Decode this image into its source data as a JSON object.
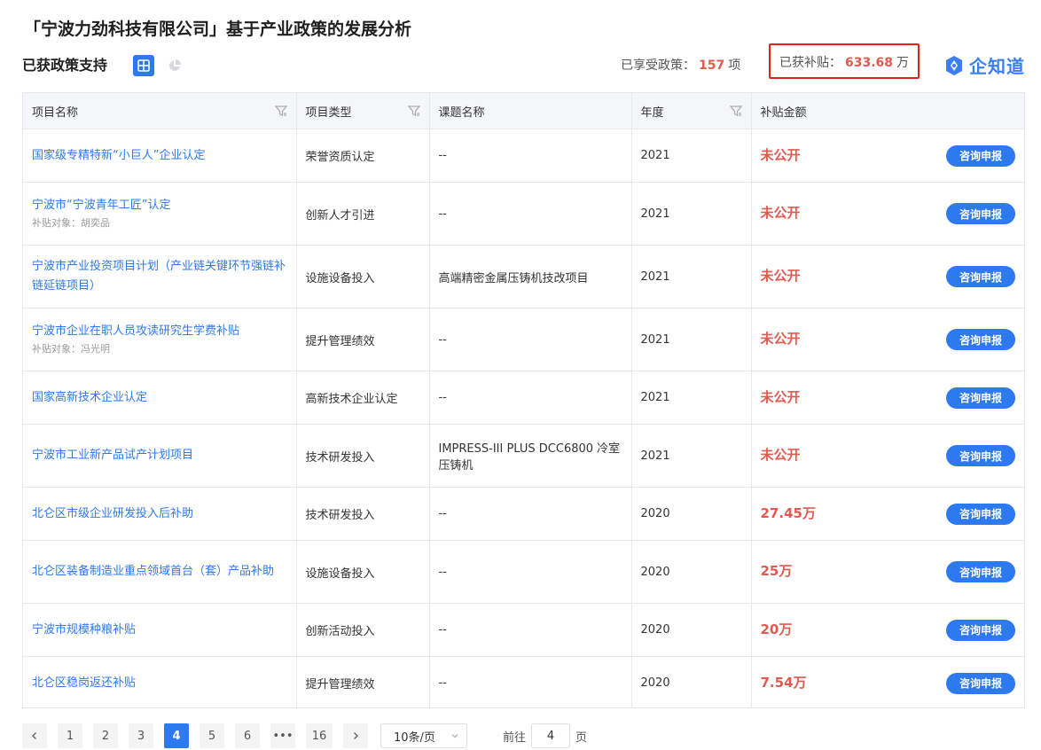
{
  "header": {
    "title": "「宁波力劲科技有限公司」基于产业政策的发展分析",
    "section_title": "已获政策支持",
    "policies_label": "已享受政策：",
    "policies_count": "157",
    "policies_unit": "项",
    "subsidy_label": "已获补贴：",
    "subsidy_amount": "633.68",
    "subsidy_unit": "万",
    "brand_name": "企知道",
    "view_icons": [
      "table-icon",
      "pie-chart-icon"
    ],
    "accent_color": "#2d79f0",
    "amount_color": "#e05a4f"
  },
  "table": {
    "columns": [
      "项目名称",
      "项目类型",
      "课题名称",
      "年度",
      "补贴金额"
    ],
    "action_label": "咨询申报",
    "rows": [
      {
        "name": "国家级专精特新“小巨人”企业认定",
        "target": "",
        "type": "荣誉资质认定",
        "topic": "--",
        "year": "2021",
        "amount": "未公开"
      },
      {
        "name": "宁波市“宁波青年工匠”认定",
        "target": "补贴对象：胡奕品",
        "type": "创新人才引进",
        "topic": "--",
        "year": "2021",
        "amount": "未公开"
      },
      {
        "name": "宁波市产业投资项目计划（产业链关键环节强链补链延链项目）",
        "target": "",
        "type": "设施设备投入",
        "topic": "高端精密金属压铸机技改项目",
        "year": "2021",
        "amount": "未公开"
      },
      {
        "name": "宁波市企业在职人员攻读研究生学费补贴",
        "target": "补贴对象：冯光明",
        "type": "提升管理绩效",
        "topic": "--",
        "year": "2021",
        "amount": "未公开"
      },
      {
        "name": "国家高新技术企业认定",
        "target": "",
        "type": "高新技术企业认定",
        "topic": "--",
        "year": "2021",
        "amount": "未公开"
      },
      {
        "name": "宁波市工业新产品试产计划项目",
        "target": "",
        "type": "技术研发投入",
        "topic": "IMPRESS-III PLUS DCC6800 冷室压铸机",
        "year": "2021",
        "amount": "未公开"
      },
      {
        "name": "北仑区市级企业研发投入后补助",
        "target": "",
        "type": "技术研发投入",
        "topic": "--",
        "year": "2020",
        "amount": "27.45万"
      },
      {
        "name": "北仑区装备制造业重点领域首台（套）产品补助",
        "target": "",
        "type": "设施设备投入",
        "topic": "--",
        "year": "2020",
        "amount": "25万"
      },
      {
        "name": "宁波市规模种粮补贴",
        "target": "",
        "type": "创新活动投入",
        "topic": "--",
        "year": "2020",
        "amount": "20万"
      },
      {
        "name": "北仑区稳岗返还补贴",
        "target": "",
        "type": "提升管理绩效",
        "topic": "--",
        "year": "2020",
        "amount": "7.54万"
      }
    ]
  },
  "pagination": {
    "pages": [
      "1",
      "2",
      "3",
      "4",
      "5",
      "6",
      "•••",
      "16"
    ],
    "current": "4",
    "page_size": "10条/页",
    "goto_prefix": "前往",
    "goto_value": "4",
    "goto_suffix": "页"
  }
}
